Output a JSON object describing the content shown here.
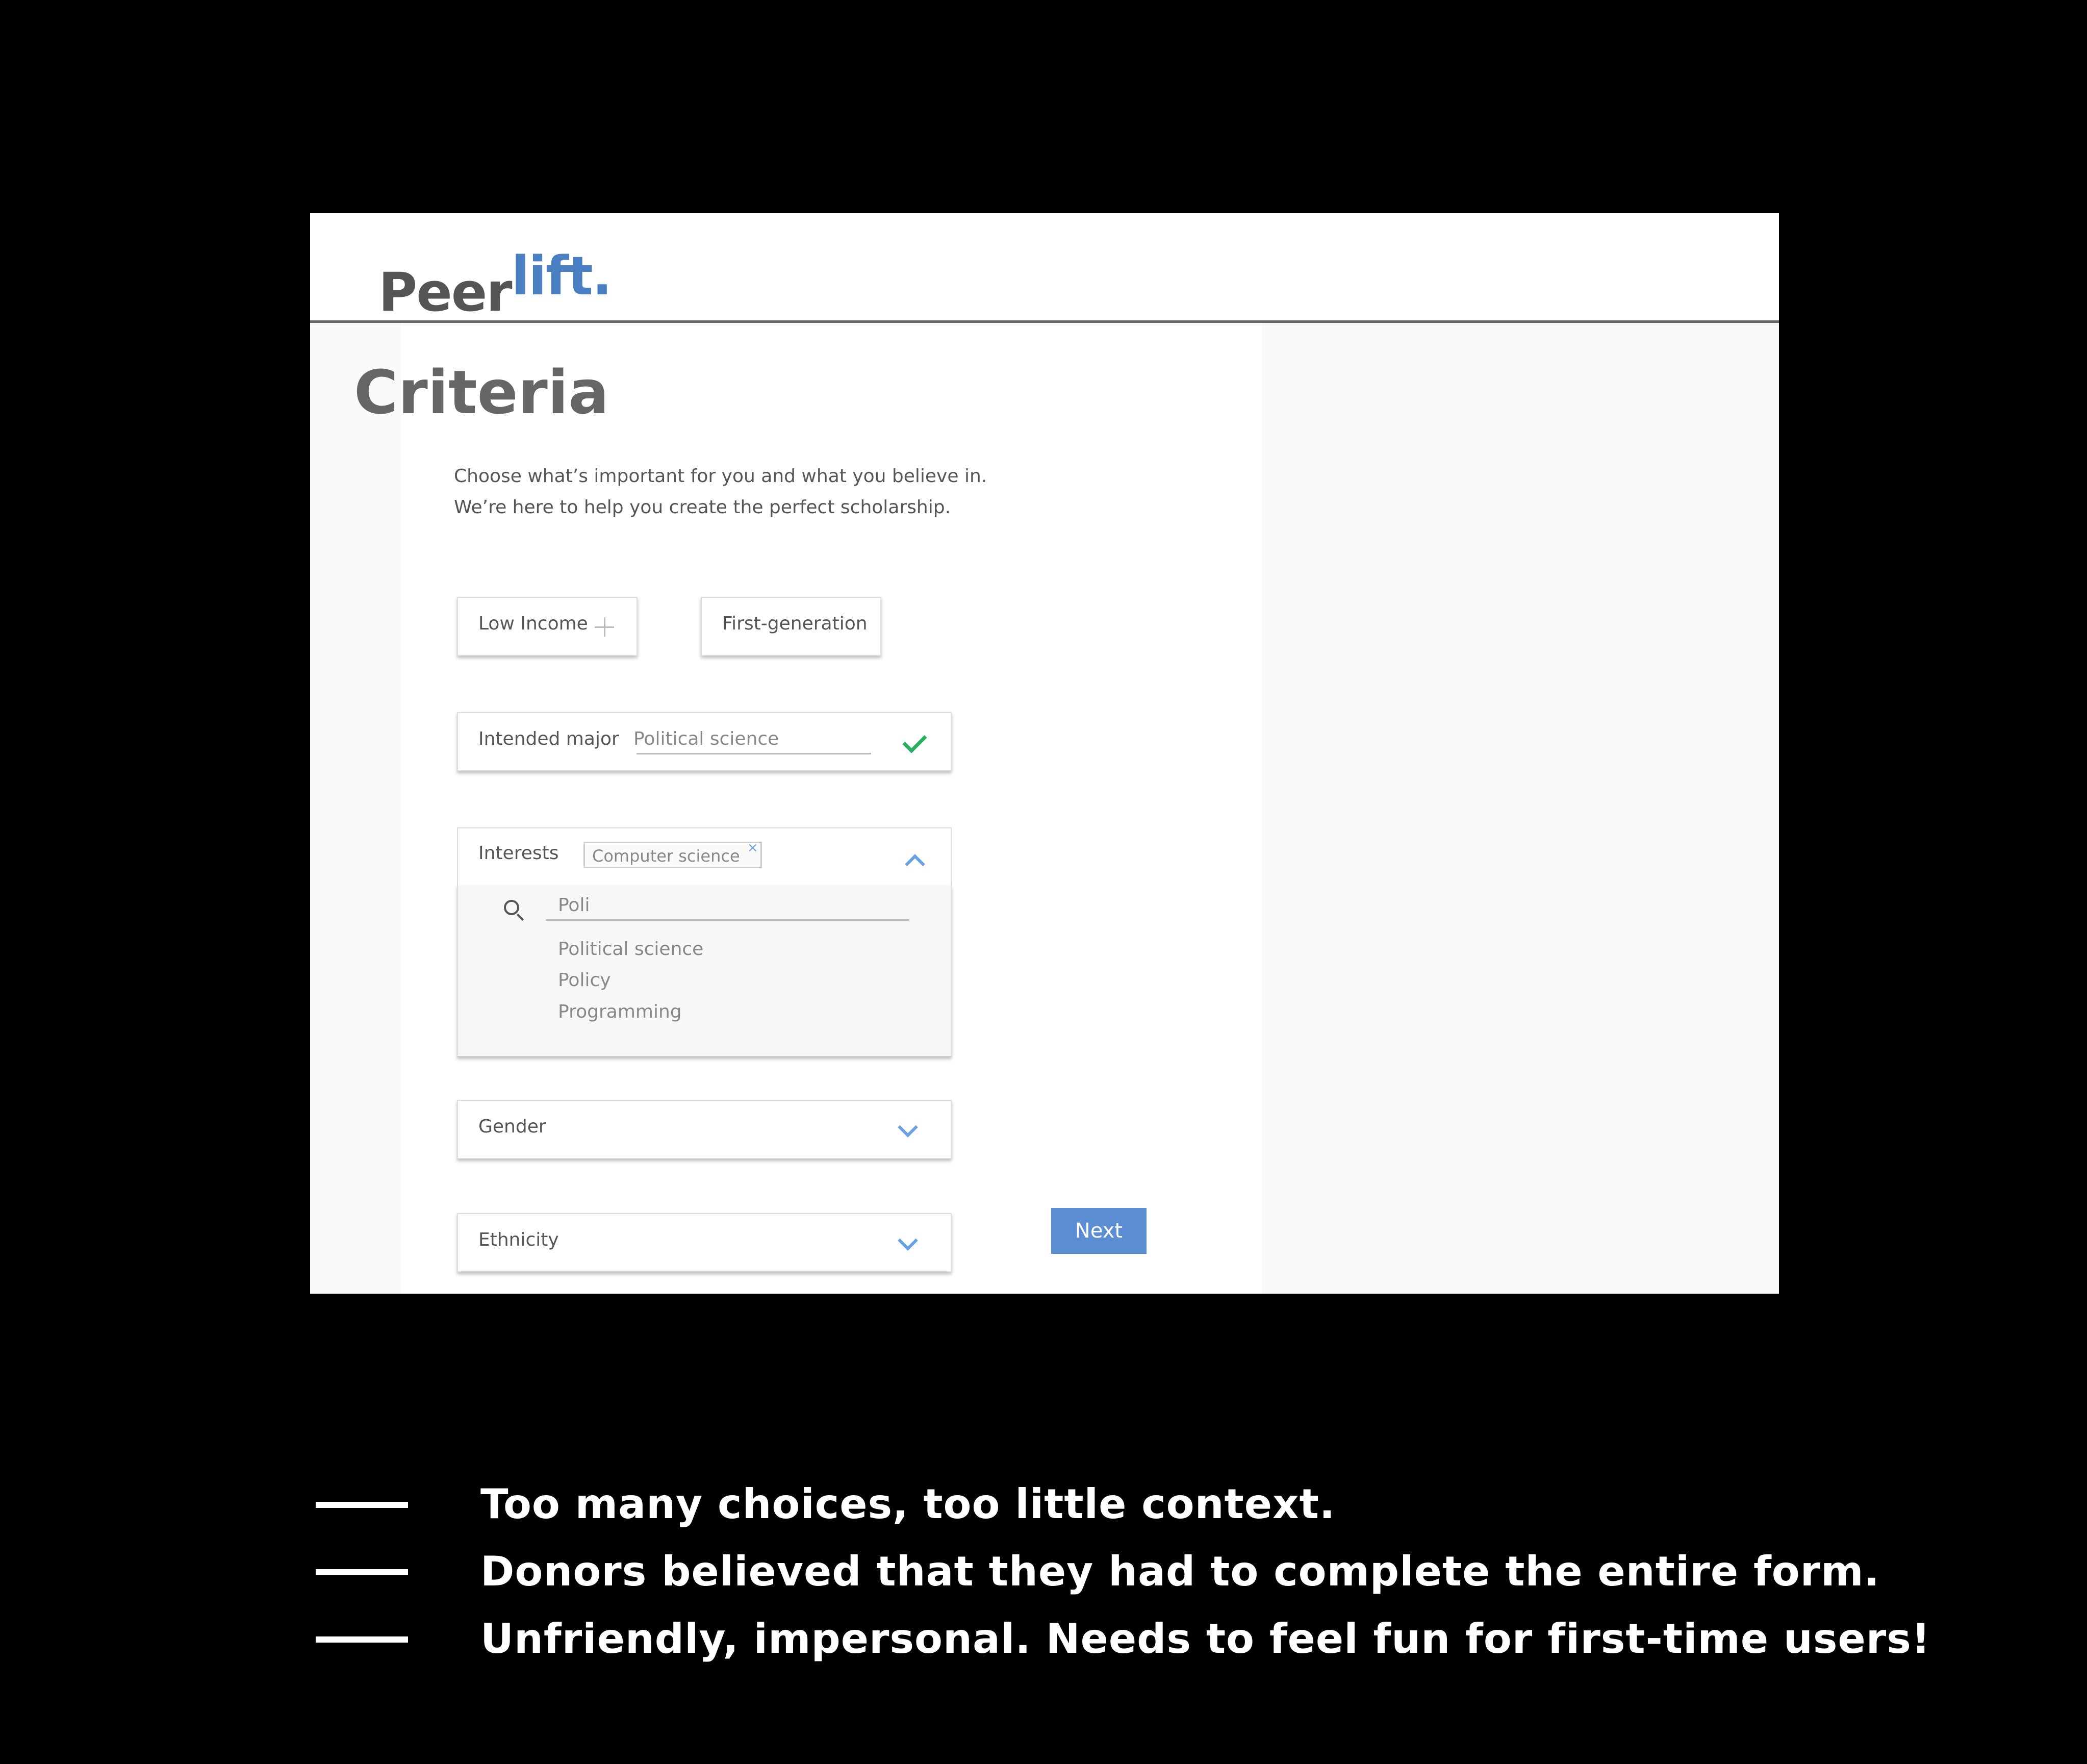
{
  "brand": {
    "part1": "Peer",
    "part2": "lift."
  },
  "page": {
    "title": "Criteria",
    "intro_line1": "Choose what’s important for you and what you believe in.",
    "intro_line2": "We’re here to help you create the perfect scholarship."
  },
  "chips": {
    "low_income": "Low Income",
    "first_generation": "First-generation"
  },
  "intended_major": {
    "label": "Intended major",
    "value": "Political science"
  },
  "interests": {
    "label": "Interests",
    "tag": "Computer science",
    "tag_remove": "×",
    "search_value": "Poli",
    "options": [
      "Political science",
      "Policy",
      "Programming"
    ]
  },
  "gender": {
    "label": "Gender"
  },
  "ethnicity": {
    "label": "Ethnicity"
  },
  "next_button": "Next",
  "notes": [
    "Too many choices, too little context.",
    "Donors believed that they had to complete the entire form.",
    "Unfriendly, impersonal.   Needs to feel fun for first-time users!"
  ],
  "colors": {
    "accent": "#5b8dd2",
    "brand_blue": "#4a7fc4",
    "check_green": "#27ae60",
    "chevron_blue": "#6aa0e6"
  }
}
